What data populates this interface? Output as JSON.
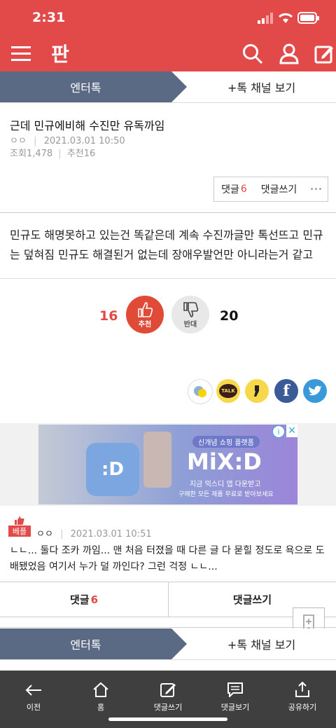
{
  "status_bar": {
    "time": "2:31"
  },
  "app": {
    "logo": "판"
  },
  "channel": {
    "name": "엔터톡",
    "more_label": "+톡 채널 보기"
  },
  "post": {
    "title": "근데 민규에비해 수진만 유독까임",
    "author": "ㅇㅇ",
    "date": "2021.03.01 10:50",
    "views": "조회1,478",
    "recommends": "추천16",
    "comments_label": "댓글",
    "comments_count": "6",
    "write_comment_label": "댓글쓰기",
    "more_label": "•••",
    "body": "민규도 해명못하고 있는건 똑같은데 계속 수진까글만 톡선뜨고 민규는 덮혀짐 민규도 해결된거 없는데 장애우발언만 아니라는거 같고"
  },
  "votes": {
    "up_count": "16",
    "up_label": "추천",
    "down_label": "반대",
    "down_count": "20"
  },
  "social": [
    "kakaostory",
    "kakaotalk",
    "kakao-comma",
    "facebook",
    "twitter"
  ],
  "social_labels": {
    "talk": "TALK"
  },
  "ad": {
    "brand": "MiX:D",
    "tag": "신개념 쇼핑 플랫폼",
    "line1": "지금 믹스디 앱 다운받고",
    "line2": "구매한 모든 제품 무료로 받아보세요",
    "app_icon": ":D"
  },
  "best_comment": {
    "badge": "베플",
    "author": "ㅇㅇ",
    "date": "2021.03.01 10:51",
    "text": "ㄴㄴ... 둘다 조카 까임... 맨 처음 터졌을 때 다른 글 다 묻힐 정도로 욕으로 도배됐었음 여기서 누가 덜 까인다? 그런 걱정 ㄴㄴ..."
  },
  "comment_bar": {
    "comments_label": "댓글",
    "comments_count": "6",
    "write_label": "댓글쓰기"
  },
  "channel2": {
    "name": "엔터톡",
    "more_label": "+톡 채널 보기"
  },
  "tabbar": {
    "items": [
      "이전",
      "홈",
      "댓글쓰기",
      "댓글보기",
      "공유하기"
    ]
  }
}
